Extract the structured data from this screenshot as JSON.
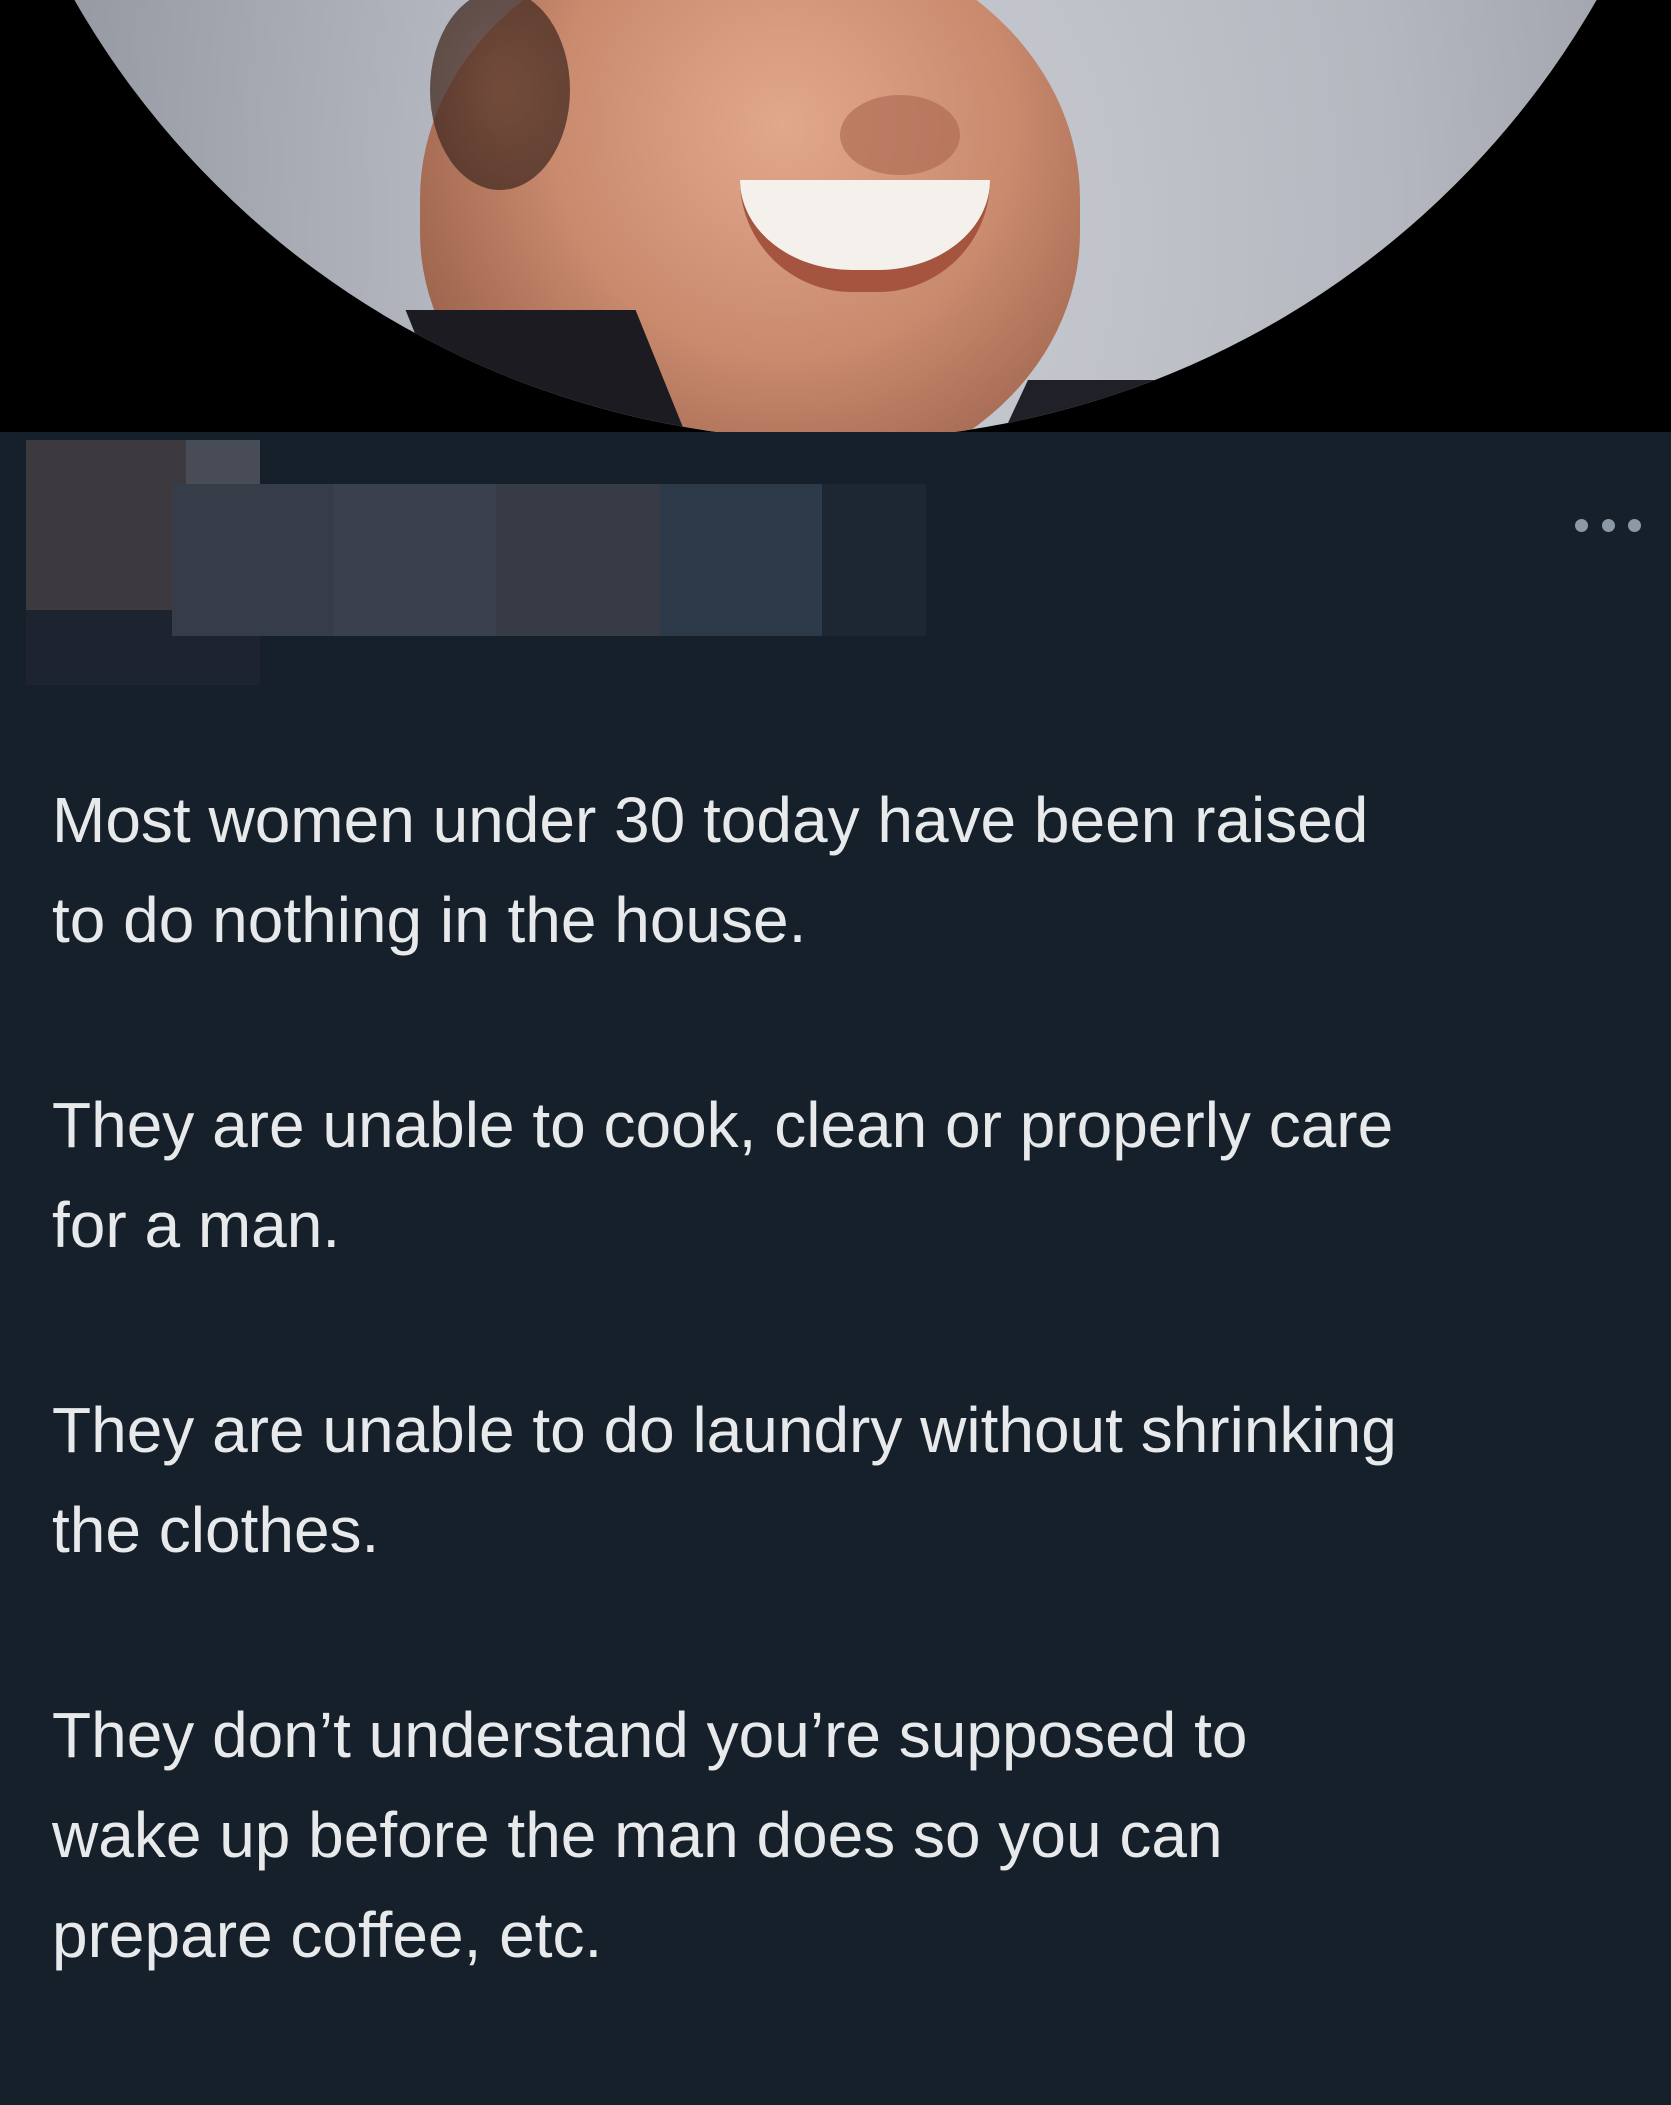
{
  "tweet": {
    "menu_icon": "more-horizontal-icon",
    "paragraphs": [
      "Most women under 30 today have been raised\nto do nothing in the house.",
      "They are unable to cook, clean or properly care\nfor a man.",
      "They are unable to do laundry without shrinking\nthe clothes.",
      "They don’t understand you’re supposed to\nwake up before the man does so you can\nprepare coffee, etc."
    ]
  },
  "colors": {
    "background": "#15202b",
    "text": "#e7e9ea",
    "muted_icon": "#8b98a5"
  }
}
